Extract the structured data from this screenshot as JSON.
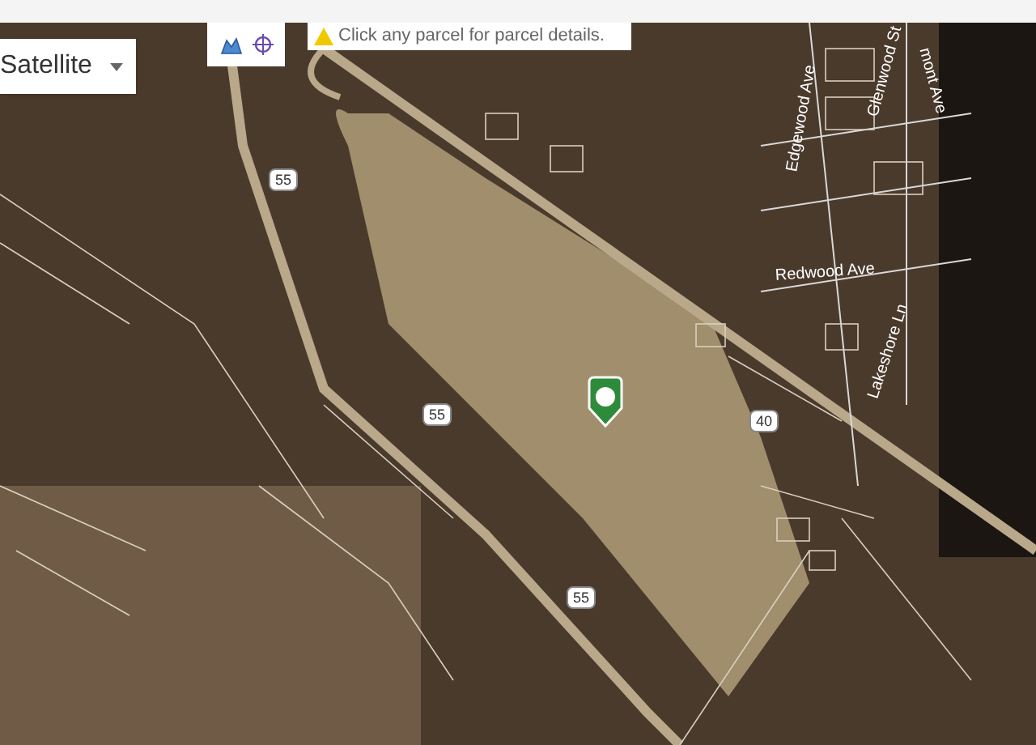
{
  "map_type": {
    "label": "Satellite"
  },
  "notice": {
    "text": "Click any parcel for parcel details."
  },
  "map_labels": [
    {
      "kind": "shield",
      "text": "55"
    },
    {
      "kind": "shield",
      "text": "55"
    },
    {
      "kind": "shield",
      "text": "55"
    },
    {
      "kind": "shield",
      "text": "40"
    },
    {
      "kind": "street",
      "text": "Edgewood Ave"
    },
    {
      "kind": "street",
      "text": "Glenwood St"
    },
    {
      "kind": "street",
      "text": "mont Ave"
    },
    {
      "kind": "street",
      "text": "Redwood Ave"
    },
    {
      "kind": "street",
      "text": "Lakeshore Ln"
    }
  ]
}
